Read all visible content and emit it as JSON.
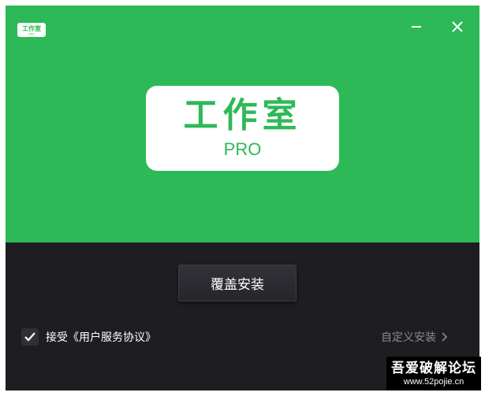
{
  "header": {
    "mini_logo_text": "工作室",
    "mini_logo_sub": "PRO",
    "colors": {
      "header_bg": "#2db957",
      "footer_bg": "#1e1d22"
    }
  },
  "logo": {
    "title": "工作室",
    "subtitle": "PRO"
  },
  "window_controls": {
    "minimize_icon": "minimize-icon",
    "close_icon": "close-icon"
  },
  "actions": {
    "install_label": "覆盖安装",
    "agree_label": "接受《用户服务协议》",
    "agree_checked": true,
    "custom_install_label": "自定义安装"
  },
  "watermark": {
    "title": "吾爱破解论坛",
    "url": "www.52pojie.cn"
  }
}
